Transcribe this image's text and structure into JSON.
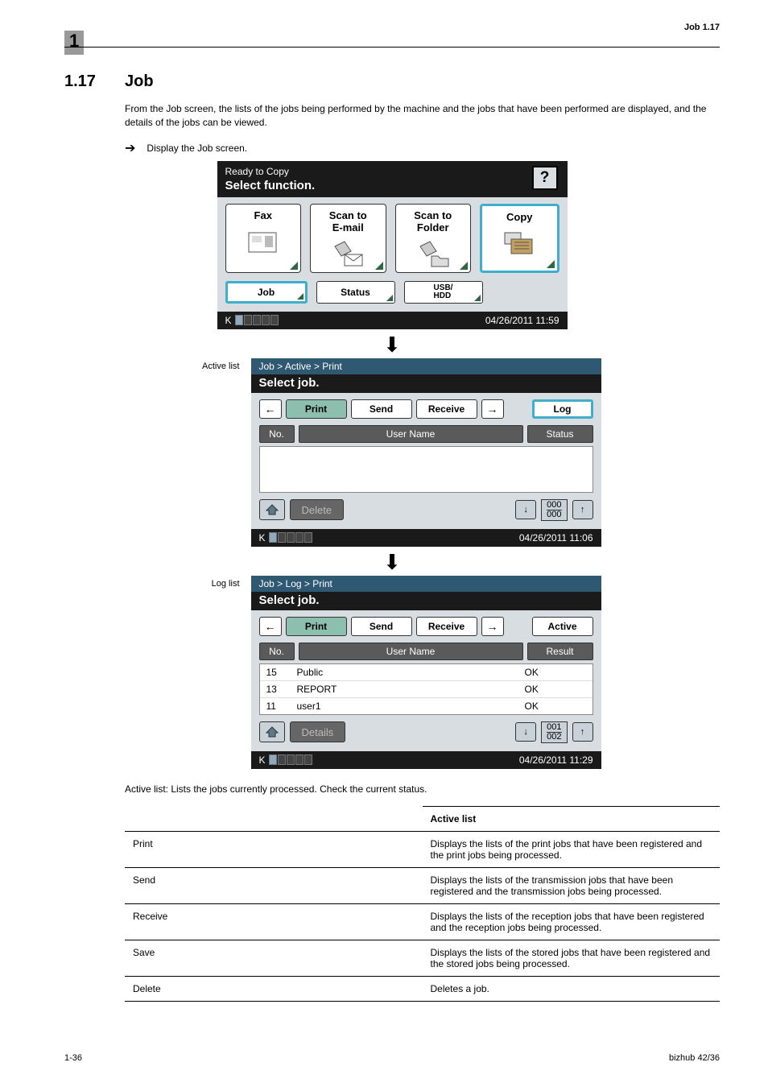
{
  "page_header": {
    "left_num": "1",
    "right": "Job    1.17"
  },
  "section": {
    "num": "1.17",
    "title": "Job"
  },
  "intro": "From the Job screen, the lists of the jobs being performed by the machine and the jobs that have been performed are displayed, and the details of the jobs can be viewed.",
  "step": "Display the Job screen.",
  "labels": {
    "active_list": "Active list",
    "log_list": "Log list"
  },
  "panel1": {
    "title": "Ready to Copy",
    "subtitle": "Select function.",
    "big_buttons": [
      "Fax",
      "Scan to\nE-mail",
      "Scan to\nFolder",
      "Copy"
    ],
    "small_buttons": [
      "Job",
      "Status",
      "USB/\nHDD"
    ],
    "datetime": "04/26/2011  11:59",
    "toner_label": "K"
  },
  "panel2": {
    "crumb": "Job > Active > Print",
    "subtitle": "Select job.",
    "tabs": [
      "Print",
      "Send",
      "Receive"
    ],
    "right_tab": "Log",
    "headers": {
      "no": "No.",
      "user": "User Name",
      "status": "Status"
    },
    "action": "Delete",
    "count_top": "000",
    "count_bot": "000",
    "datetime": "04/26/2011  11:06",
    "toner_label": "K"
  },
  "panel3": {
    "crumb": "Job > Log > Print",
    "subtitle": "Select job.",
    "tabs": [
      "Print",
      "Send",
      "Receive"
    ],
    "right_tab": "Active",
    "headers": {
      "no": "No.",
      "user": "User Name",
      "result": "Result"
    },
    "rows": [
      {
        "no": "15",
        "user": "Public",
        "result": "OK"
      },
      {
        "no": "13",
        "user": "REPORT",
        "result": "OK"
      },
      {
        "no": "11",
        "user": "user1",
        "result": "OK"
      }
    ],
    "action": "Details",
    "count_top": "001",
    "count_bot": "002",
    "datetime": "04/26/2011  11:29",
    "toner_label": "K"
  },
  "desc": "Active list: Lists the jobs currently processed. Check the current status.",
  "table": {
    "header": "Active list",
    "rows": [
      {
        "name": "Print",
        "desc": "Displays the lists of the print jobs that have been registered and the print jobs being processed."
      },
      {
        "name": "Send",
        "desc": "Displays the lists of the transmission jobs that have been registered and the transmission jobs being processed."
      },
      {
        "name": "Receive",
        "desc": "Displays the lists of the reception jobs that have been registered and the reception jobs being processed."
      },
      {
        "name": "Save",
        "desc": "Displays the lists of the stored jobs that have been registered and the stored jobs being processed."
      },
      {
        "name": "Delete",
        "desc": "Deletes a job."
      }
    ]
  },
  "footer": {
    "left": "1-36",
    "right": "bizhub 42/36"
  }
}
